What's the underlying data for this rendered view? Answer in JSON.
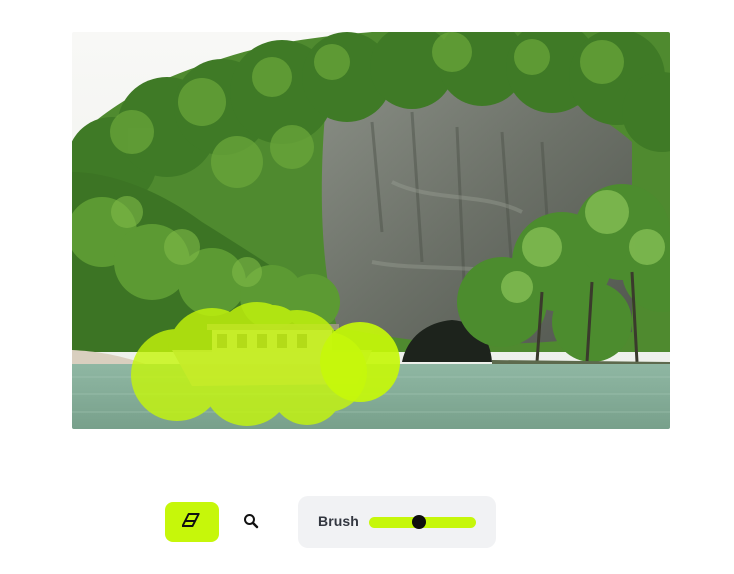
{
  "image_editor": {
    "photo_description_icon": "landscape-photo",
    "mask_color": "#c6f70a",
    "mask_opacity": 0.8
  },
  "toolbar": {
    "eraser_icon": "eraser-icon",
    "eraser_active": true,
    "zoom_icon": "magnifier-icon",
    "brush": {
      "label": "Brush",
      "value": 0.47
    }
  },
  "colors": {
    "accent": "#c6f70a",
    "panel_background": "#f1f2f4",
    "text": "#333740",
    "thumb": "#0e0e0e"
  }
}
